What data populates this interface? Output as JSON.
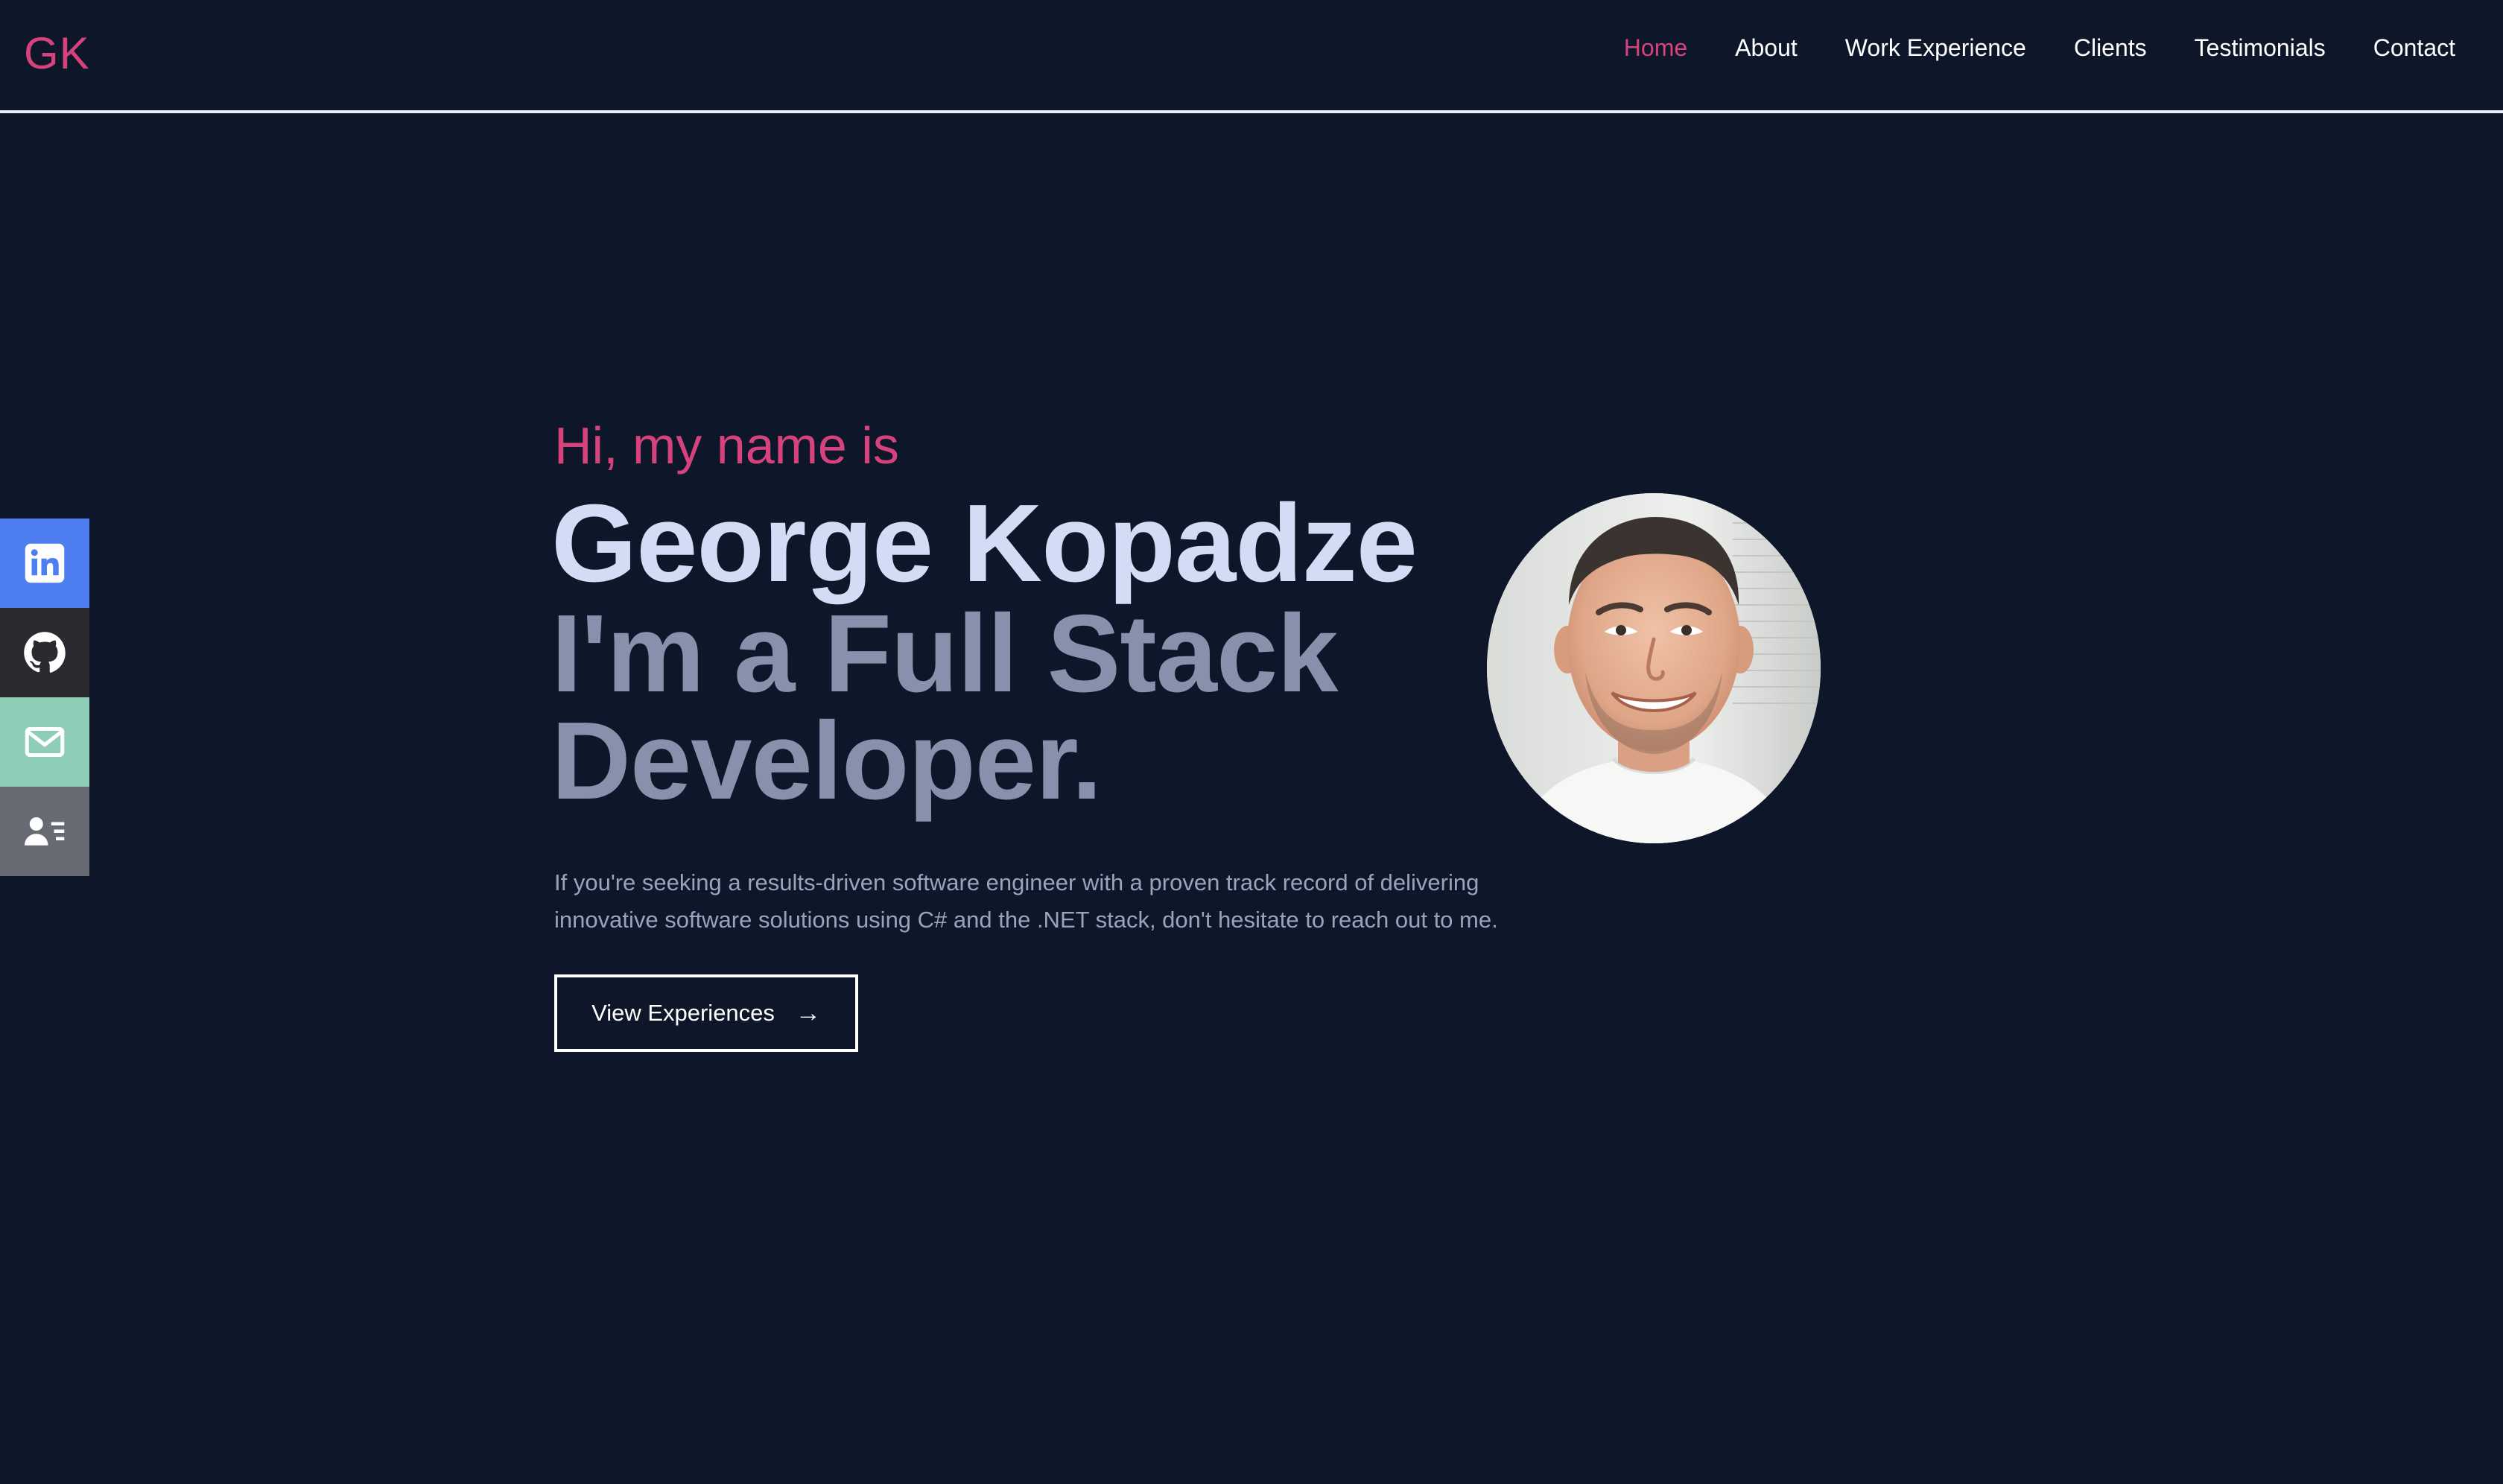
{
  "header": {
    "logo": "GK",
    "nav": [
      {
        "label": "Home",
        "active": true
      },
      {
        "label": "About",
        "active": false
      },
      {
        "label": "Work Experience",
        "active": false
      },
      {
        "label": "Clients",
        "active": false
      },
      {
        "label": "Testimonials",
        "active": false
      },
      {
        "label": "Contact",
        "active": false
      }
    ]
  },
  "social": [
    {
      "icon": "linkedin-icon",
      "color": "#4f7ef0"
    },
    {
      "icon": "github-icon",
      "color": "#2a2a30"
    },
    {
      "icon": "mail-icon",
      "color": "#8ecdb6"
    },
    {
      "icon": "resume-icon",
      "color": "#676a73"
    }
  ],
  "hero": {
    "greeting": "Hi, my name is",
    "name": "George Kopadze",
    "role": "I'm a Full Stack Developer.",
    "description": "If you're seeking a results-driven software engineer with a proven track record of delivering innovative software solutions using C# and the .NET stack, don't hesitate to reach out to me.",
    "cta_label": "View Experiences",
    "cta_icon": "arrow-right-icon"
  },
  "colors": {
    "background": "#0e172a",
    "accent": "#d6437c",
    "name": "#d4dbf5",
    "role": "#8891ac",
    "body_text": "#9aa3bb"
  }
}
